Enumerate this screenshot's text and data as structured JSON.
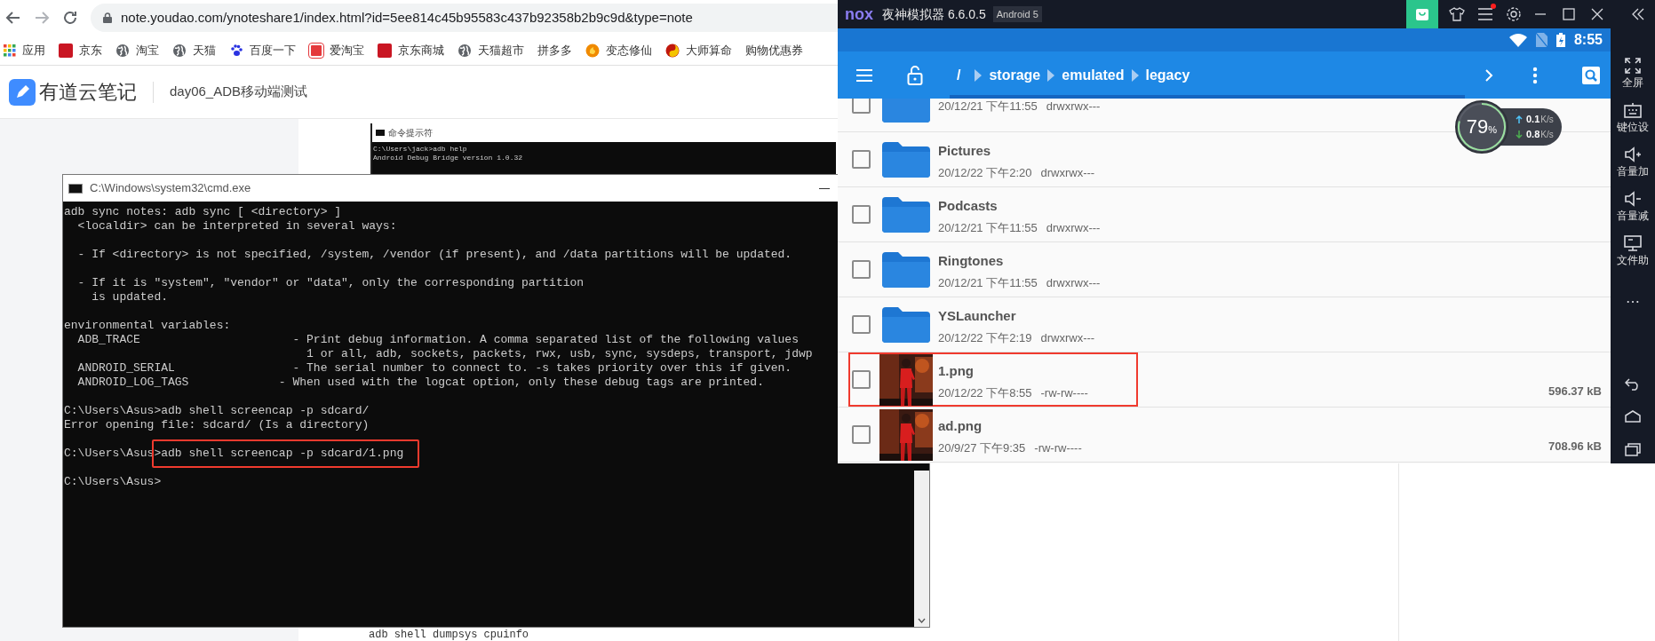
{
  "browser": {
    "url": "note.youdao.com/ynoteshare1/index.html?id=5ee814c45b95583c437b92358b2b9c9d&type=note",
    "bookmarks": [
      {
        "label": "应用",
        "kind": "apps"
      },
      {
        "label": "京东",
        "kind": "jd"
      },
      {
        "label": "淘宝",
        "kind": "globe"
      },
      {
        "label": "天猫",
        "kind": "globe"
      },
      {
        "label": "百度一下",
        "kind": "paw"
      },
      {
        "label": "爱淘宝",
        "kind": "tao"
      },
      {
        "label": "京东商城",
        "kind": "jd"
      },
      {
        "label": "天猫超市",
        "kind": "globe"
      },
      {
        "label": "拼多多",
        "kind": "plain"
      },
      {
        "label": "变态修仙",
        "kind": "flame"
      },
      {
        "label": "大师算命",
        "kind": "yinyang"
      },
      {
        "label": "购物优惠券",
        "kind": "plain"
      }
    ],
    "site": {
      "brand": "有道云笔记",
      "note_title": "day06_ADB移动端测试"
    }
  },
  "note_content": {
    "embedded_window": {
      "title": "命令提示符",
      "lines": [
        "C:\\Users\\jack>adb help",
        "Android Debug Bridge version 1.0.32"
      ]
    },
    "code_line": "adb shell dumpsys cpuinfo"
  },
  "cmd_window": {
    "title": "C:\\Windows\\system32\\cmd.exe",
    "blocks": [
      [
        {
          "kind": "output",
          "text": "adb sync notes: adb sync [ <directory> ]"
        },
        {
          "kind": "output",
          "text": "  <localdir> can be interpreted in several ways:"
        }
      ],
      [
        {
          "kind": "output",
          "text": "  - If <directory> is not specified, /system, /vendor (if present), and /data partitions will be updated."
        }
      ],
      [
        {
          "kind": "output",
          "text": "  - If it is \"system\", \"vendor\" or \"data\", only the corresponding partition"
        },
        {
          "kind": "output",
          "text": "    is updated."
        }
      ],
      [
        {
          "kind": "output",
          "text": "environmental variables:"
        },
        {
          "kind": "output",
          "text": "  ADB_TRACE                      - Print debug information. A comma separated list of the following values"
        },
        {
          "kind": "output",
          "text": "                                   1 or all, adb, sockets, packets, rwx, usb, sync, sysdeps, transport, jdwp"
        },
        {
          "kind": "output",
          "text": "  ANDROID_SERIAL                 - The serial number to connect to. -s takes priority over this if given."
        },
        {
          "kind": "output",
          "text": "  ANDROID_LOG_TAGS             - When used with the logcat option, only these debug tags are printed."
        }
      ],
      [
        {
          "kind": "command",
          "prompt": "C:\\Users\\Asus>",
          "command": "adb shell screencap -p sdcard/",
          "highlighted": false
        },
        {
          "kind": "output",
          "text": "Error opening file: sdcard/ (Is a directory)"
        }
      ],
      [
        {
          "kind": "command",
          "prompt": "C:\\Users\\Asus>",
          "command": "adb shell screencap -p sdcard/1.png",
          "highlighted": true
        }
      ],
      [
        {
          "kind": "prompt",
          "prompt": "C:\\Users\\Asus>"
        }
      ]
    ]
  },
  "emulator": {
    "brand": "nox",
    "title": "夜神模拟器 6.6.0.5",
    "android_badge": "Android 5",
    "notification": true,
    "clock": "8:55",
    "path": [
      "/",
      "storage",
      "emulated",
      "legacy"
    ],
    "monitor": {
      "percent": "79",
      "percent_sign": "%",
      "upload": "0.1",
      "upload_unit": "K/s",
      "download": "0.8",
      "download_unit": "K/s"
    },
    "files": [
      {
        "kind": "folder",
        "partial": true,
        "date": "20/12/21 下午11:55",
        "perms": "drwxrwx---",
        "checked": false,
        "highlighted": false
      },
      {
        "kind": "folder",
        "partial": false,
        "name": "Pictures",
        "date": "20/12/22 下午2:20",
        "perms": "drwxrwx---",
        "checked": false,
        "highlighted": false
      },
      {
        "kind": "folder",
        "partial": false,
        "name": "Podcasts",
        "date": "20/12/21 下午11:55",
        "perms": "drwxrwx---",
        "checked": false,
        "highlighted": false
      },
      {
        "kind": "folder",
        "partial": false,
        "name": "Ringtones",
        "date": "20/12/21 下午11:55",
        "perms": "drwxrwx---",
        "checked": false,
        "highlighted": false
      },
      {
        "kind": "folder",
        "partial": false,
        "name": "YSLauncher",
        "date": "20/12/22 下午2:19",
        "perms": "drwxrwx---",
        "checked": false,
        "highlighted": false
      },
      {
        "partial": false,
        "name": "1.png",
        "date": "20/12/22 下午8:55",
        "perms": "-rw-rw----",
        "size": "596.37 kB",
        "checked": false,
        "highlighted": true
      },
      {
        "partial": false,
        "name": "ad.png",
        "date": "20/9/27 下午9:35",
        "perms": "-rw-rw----",
        "size": "708.96 kB",
        "checked": false,
        "highlighted": false
      }
    ],
    "sidebar": [
      {
        "kind": "fullscreen",
        "label": "全屏"
      },
      {
        "kind": "keyboard",
        "label": "键位设"
      },
      {
        "kind": "volume-up",
        "label": "音量加"
      },
      {
        "kind": "volume-down",
        "label": "音量减"
      },
      {
        "kind": "monitor",
        "label": "文件助"
      },
      {
        "kind": "more",
        "label": "⋯"
      }
    ]
  }
}
